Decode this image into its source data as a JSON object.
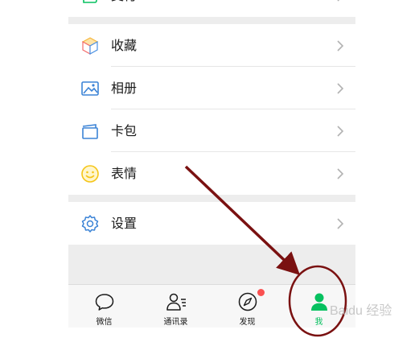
{
  "menu": {
    "items": [
      {
        "label": "支付",
        "icon": "wallet-icon"
      },
      {
        "label": "收藏",
        "icon": "cube-icon"
      },
      {
        "label": "相册",
        "icon": "picture-icon"
      },
      {
        "label": "卡包",
        "icon": "card-wallet-icon"
      },
      {
        "label": "表情",
        "icon": "smile-icon"
      },
      {
        "label": "设置",
        "icon": "gear-icon"
      }
    ]
  },
  "tabbar": {
    "tabs": [
      {
        "label": "微信",
        "icon": "chat-bubble-icon",
        "active": false
      },
      {
        "label": "通讯录",
        "icon": "contacts-icon",
        "active": false
      },
      {
        "label": "发现",
        "icon": "compass-icon",
        "active": false,
        "badge": "dot"
      },
      {
        "label": "我",
        "icon": "person-icon",
        "active": true
      }
    ]
  },
  "watermark": {
    "text": "Baidu 经验"
  },
  "colors": {
    "accent": "#07c160",
    "badge": "#fa5151",
    "annotation": "#7a1111",
    "page_bg": "#ededed"
  }
}
